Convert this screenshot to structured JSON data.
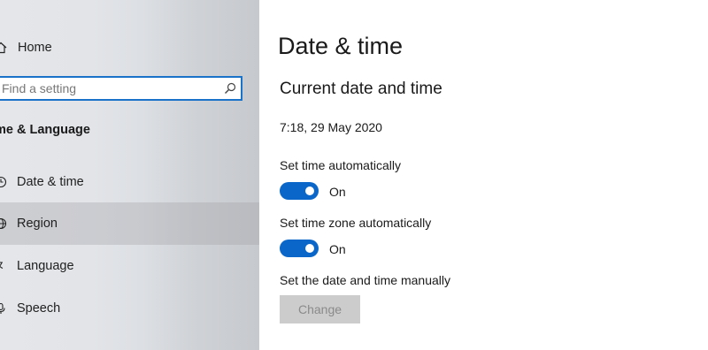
{
  "sidebar": {
    "home_label": "Home",
    "search": {
      "placeholder": "Find a setting",
      "value": ""
    },
    "section_title": "me & Language",
    "items": [
      {
        "label": "Date & time",
        "icon": "clock-icon",
        "selected": false
      },
      {
        "label": "Region",
        "icon": "globe-icon",
        "selected": true
      },
      {
        "label": "Language",
        "icon": "language-icon",
        "selected": false
      },
      {
        "label": "Speech",
        "icon": "microphone-icon",
        "selected": false
      }
    ]
  },
  "main": {
    "title": "Date & time",
    "subtitle": "Current date and time",
    "current_datetime": "7:18, 29 May 2020",
    "settings": [
      {
        "label": "Set time automatically",
        "toggle_state": "On",
        "enabled": true
      },
      {
        "label": "Set time zone automatically",
        "toggle_state": "On",
        "enabled": true
      }
    ],
    "manual": {
      "label": "Set the date and time manually",
      "button_label": "Change",
      "button_disabled": true
    }
  },
  "colors": {
    "accent": "#0a67c9",
    "search_border": "#1a73c9",
    "sidebar_bg": "#e2e4e8",
    "disabled_button_bg": "#cccccc",
    "disabled_button_text": "#8a8a8a"
  }
}
